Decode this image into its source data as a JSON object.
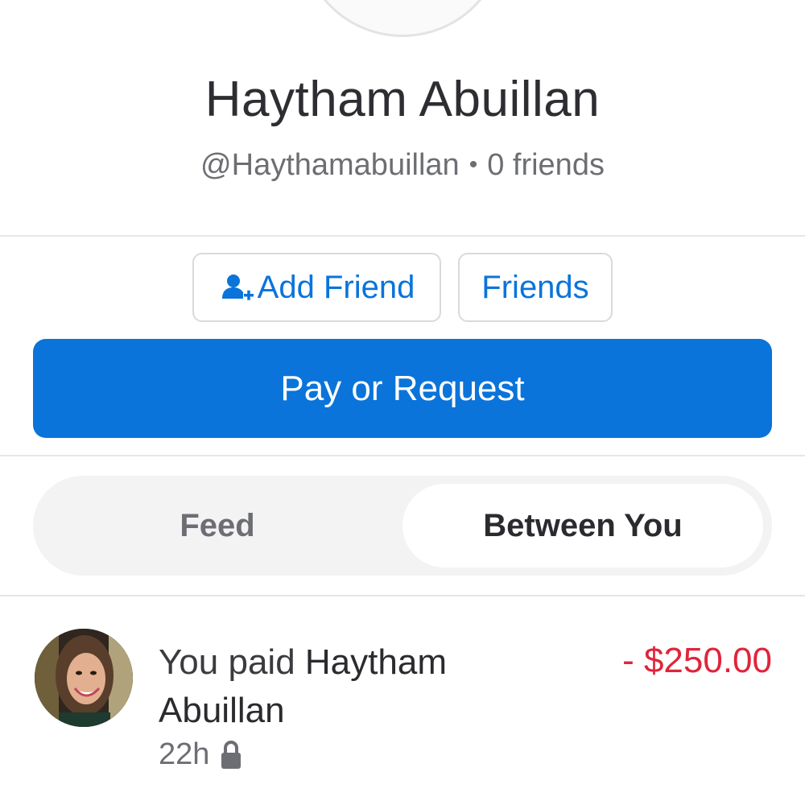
{
  "profile": {
    "name": "Haytham Abuillan",
    "handle": "@Haythamabuillan",
    "separator": "•",
    "friends_count": "0 friends"
  },
  "actions": {
    "add_friend_label": "Add Friend",
    "friends_label": "Friends",
    "pay_request_label": "Pay or Request"
  },
  "tabs": [
    {
      "label": "Feed",
      "selected": false
    },
    {
      "label": "Between You",
      "selected": true
    }
  ],
  "transactions": [
    {
      "verb": "You paid",
      "counterparty": "Haytham Abuillan",
      "amount": "- $250.00",
      "time": "22h",
      "privacy_icon": "lock-icon"
    }
  ],
  "colors": {
    "accent": "#0a74da",
    "negative": "#e0243b",
    "muted": "#6d6e73"
  },
  "icons": [
    "add-friend-icon",
    "lock-icon"
  ]
}
